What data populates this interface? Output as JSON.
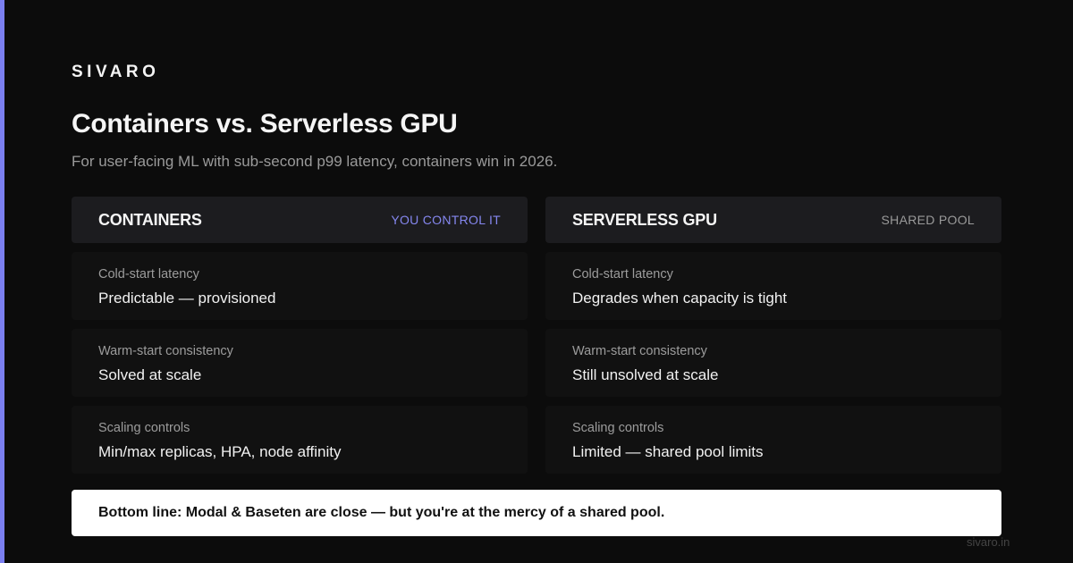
{
  "brand": "SIVARO",
  "title": "Containers vs. Serverless GPU",
  "subtitle": "For user-facing ML with sub-second p99 latency, containers win in 2026.",
  "colors": {
    "accent": "#7b7ff0",
    "background": "#0c0c0c"
  },
  "columns": [
    {
      "name": "CONTAINERS",
      "tag": "YOU CONTROL IT",
      "rows": [
        {
          "label": "Cold-start latency",
          "value": "Predictable — provisioned"
        },
        {
          "label": "Warm-start consistency",
          "value": "Solved at scale"
        },
        {
          "label": "Scaling controls",
          "value": "Min/max replicas, HPA, node affinity"
        }
      ]
    },
    {
      "name": "SERVERLESS GPU",
      "tag": "SHARED POOL",
      "rows": [
        {
          "label": "Cold-start latency",
          "value": "Degrades when capacity is tight"
        },
        {
          "label": "Warm-start consistency",
          "value": "Still unsolved at scale"
        },
        {
          "label": "Scaling controls",
          "value": "Limited — shared pool limits"
        }
      ]
    }
  ],
  "bottom_line": "Bottom line: Modal & Baseten are close — but you're at the mercy of a shared pool.",
  "footer_url": "sivaro.in"
}
